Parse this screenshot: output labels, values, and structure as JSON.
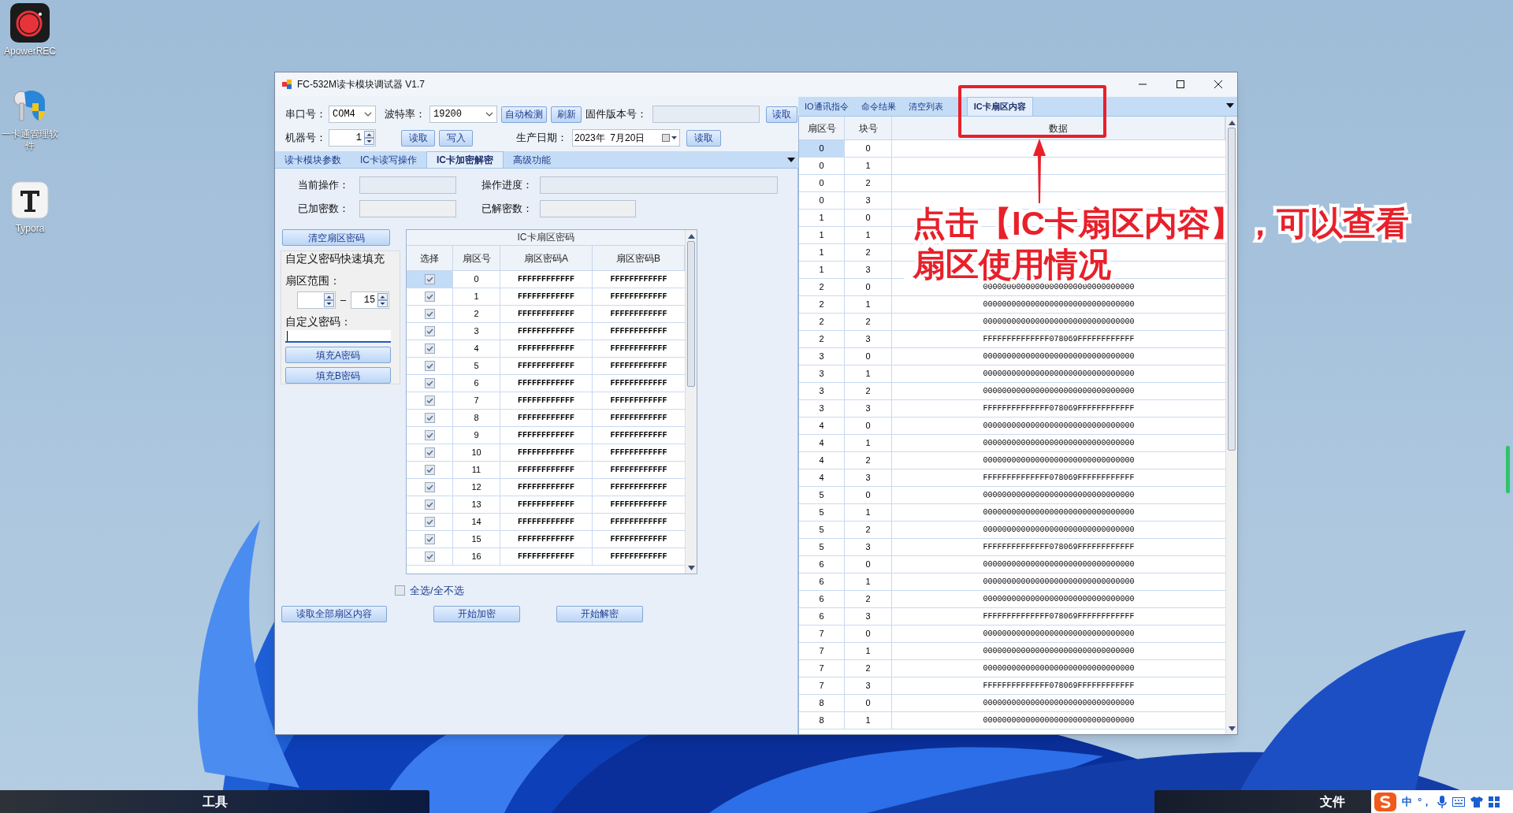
{
  "desktop": {
    "icons": [
      {
        "label": "ApowerREC",
        "kind": "recorder"
      },
      {
        "label": "一卡通管理软件",
        "kind": "keys"
      },
      {
        "label": "Typora",
        "kind": "typora"
      }
    ]
  },
  "window": {
    "title": "FC-532M读卡模块调试器 V1.7"
  },
  "toolbar": {
    "port_label": "串口号：",
    "port": "COM4",
    "baud_label": "波特率：",
    "baud": "19200",
    "auto_detect": "自动检测",
    "refresh": "刷新",
    "firmware_label": "固件版本号：",
    "firmware_read": "读取",
    "machine_label": "机器号：",
    "machine": "1",
    "machine_read": "读取",
    "machine_write": "写入",
    "date_label": "生产日期：",
    "date": "2023年  7月20日",
    "date_read": "读取"
  },
  "left_tabs": [
    {
      "label": "读卡模块参数",
      "selected": false
    },
    {
      "label": "IC卡读写操作",
      "selected": false
    },
    {
      "label": "IC卡加密解密",
      "selected": true
    },
    {
      "label": "高级功能",
      "selected": false
    }
  ],
  "crypto": {
    "current_op_label": "当前操作：",
    "progress_label": "操作进度：",
    "encrypted_label": "已加密数：",
    "decrypted_label": "已解密数：",
    "clear_button": "清空扇区密码",
    "quick_fill": {
      "title": "自定义密码快速填充",
      "range_label": "扇区范围：",
      "range_to": "15",
      "dash": "–",
      "password_label": "自定义密码：",
      "fill_a": "填充A密码",
      "fill_b": "填充B密码"
    },
    "table": {
      "title": "IC卡扇区密码",
      "columns": [
        "选择",
        "扇区号",
        "扇区密码A",
        "扇区密码B"
      ],
      "rows": [
        {
          "checked": true,
          "selected": true,
          "sector": "0",
          "key_a": "FFFFFFFFFFFF",
          "key_b": "FFFFFFFFFFFF"
        },
        {
          "checked": true,
          "selected": false,
          "sector": "1",
          "key_a": "FFFFFFFFFFFF",
          "key_b": "FFFFFFFFFFFF"
        },
        {
          "checked": true,
          "selected": false,
          "sector": "2",
          "key_a": "FFFFFFFFFFFF",
          "key_b": "FFFFFFFFFFFF"
        },
        {
          "checked": true,
          "selected": false,
          "sector": "3",
          "key_a": "FFFFFFFFFFFF",
          "key_b": "FFFFFFFFFFFF"
        },
        {
          "checked": true,
          "selected": false,
          "sector": "4",
          "key_a": "FFFFFFFFFFFF",
          "key_b": "FFFFFFFFFFFF"
        },
        {
          "checked": true,
          "selected": false,
          "sector": "5",
          "key_a": "FFFFFFFFFFFF",
          "key_b": "FFFFFFFFFFFF"
        },
        {
          "checked": true,
          "selected": false,
          "sector": "6",
          "key_a": "FFFFFFFFFFFF",
          "key_b": "FFFFFFFFFFFF"
        },
        {
          "checked": true,
          "selected": false,
          "sector": "7",
          "key_a": "FFFFFFFFFFFF",
          "key_b": "FFFFFFFFFFFF"
        },
        {
          "checked": true,
          "selected": false,
          "sector": "8",
          "key_a": "FFFFFFFFFFFF",
          "key_b": "FFFFFFFFFFFF"
        },
        {
          "checked": true,
          "selected": false,
          "sector": "9",
          "key_a": "FFFFFFFFFFFF",
          "key_b": "FFFFFFFFFFFF"
        },
        {
          "checked": true,
          "selected": false,
          "sector": "10",
          "key_a": "FFFFFFFFFFFF",
          "key_b": "FFFFFFFFFFFF"
        },
        {
          "checked": true,
          "selected": false,
          "sector": "11",
          "key_a": "FFFFFFFFFFFF",
          "key_b": "FFFFFFFFFFFF"
        },
        {
          "checked": true,
          "selected": false,
          "sector": "12",
          "key_a": "FFFFFFFFFFFF",
          "key_b": "FFFFFFFFFFFF"
        },
        {
          "checked": true,
          "selected": false,
          "sector": "13",
          "key_a": "FFFFFFFFFFFF",
          "key_b": "FFFFFFFFFFFF"
        },
        {
          "checked": true,
          "selected": false,
          "sector": "14",
          "key_a": "FFFFFFFFFFFF",
          "key_b": "FFFFFFFFFFFF"
        },
        {
          "checked": true,
          "selected": false,
          "sector": "15",
          "key_a": "FFFFFFFFFFFF",
          "key_b": "FFFFFFFFFFFF"
        },
        {
          "checked": true,
          "selected": false,
          "sector": "16",
          "key_a": "FFFFFFFFFFFF",
          "key_b": "FFFFFFFFFFFF"
        }
      ]
    },
    "select_all": {
      "label": "全选/全不选",
      "checked": false
    },
    "buttons": [
      "读取全部扇区内容",
      "开始加密",
      "开始解密"
    ]
  },
  "right_tabs": [
    {
      "label": "IO通讯指令",
      "selected": false
    },
    {
      "label": "命令结果",
      "selected": false
    },
    {
      "label": "清空列表",
      "selected": false
    },
    {
      "label": "IC卡扇区内容",
      "selected": true
    }
  ],
  "sector_table": {
    "columns": [
      "扇区号",
      "块号",
      "数据"
    ],
    "rows": [
      {
        "sector": "0",
        "block": "0",
        "selected": true
      },
      {
        "sector": "0",
        "block": "1",
        "selected": false
      },
      {
        "sector": "0",
        "block": "2",
        "selected": false
      },
      {
        "sector": "0",
        "block": "3",
        "selected": false
      },
      {
        "sector": "1",
        "block": "0",
        "selected": false
      },
      {
        "sector": "1",
        "block": "1",
        "selected": false
      },
      {
        "sector": "1",
        "block": "2",
        "selected": false
      },
      {
        "sector": "1",
        "block": "3",
        "selected": false
      },
      {
        "sector": "2",
        "block": "0",
        "selected": false,
        "data": "00000000000000000000000000000000"
      },
      {
        "sector": "2",
        "block": "1",
        "selected": false,
        "data": "00000000000000000000000000000000"
      },
      {
        "sector": "2",
        "block": "2",
        "selected": false,
        "data": "00000000000000000000000000000000"
      },
      {
        "sector": "2",
        "block": "3",
        "selected": false,
        "data": "FFFFFFFFFFFFFF078069FFFFFFFFFFFF"
      },
      {
        "sector": "3",
        "block": "0",
        "selected": false,
        "data": "00000000000000000000000000000000"
      },
      {
        "sector": "3",
        "block": "1",
        "selected": false,
        "data": "00000000000000000000000000000000"
      },
      {
        "sector": "3",
        "block": "2",
        "selected": false,
        "data": "00000000000000000000000000000000"
      },
      {
        "sector": "3",
        "block": "3",
        "selected": false,
        "data": "FFFFFFFFFFFFFF078069FFFFFFFFFFFF"
      },
      {
        "sector": "4",
        "block": "0",
        "selected": false,
        "data": "00000000000000000000000000000000"
      },
      {
        "sector": "4",
        "block": "1",
        "selected": false,
        "data": "00000000000000000000000000000000"
      },
      {
        "sector": "4",
        "block": "2",
        "selected": false,
        "data": "00000000000000000000000000000000"
      },
      {
        "sector": "4",
        "block": "3",
        "selected": false,
        "data": "FFFFFFFFFFFFFF078069FFFFFFFFFFFF"
      },
      {
        "sector": "5",
        "block": "0",
        "selected": false,
        "data": "00000000000000000000000000000000"
      },
      {
        "sector": "5",
        "block": "1",
        "selected": false,
        "data": "00000000000000000000000000000000"
      },
      {
        "sector": "5",
        "block": "2",
        "selected": false,
        "data": "00000000000000000000000000000000"
      },
      {
        "sector": "5",
        "block": "3",
        "selected": false,
        "data": "FFFFFFFFFFFFFF078069FFFFFFFFFFFF"
      },
      {
        "sector": "6",
        "block": "0",
        "selected": false,
        "data": "00000000000000000000000000000000"
      },
      {
        "sector": "6",
        "block": "1",
        "selected": false,
        "data": "00000000000000000000000000000000"
      },
      {
        "sector": "6",
        "block": "2",
        "selected": false,
        "data": "00000000000000000000000000000000"
      },
      {
        "sector": "6",
        "block": "3",
        "selected": false,
        "data": "FFFFFFFFFFFFFF078069FFFFFFFFFFFF"
      },
      {
        "sector": "7",
        "block": "0",
        "selected": false,
        "data": "00000000000000000000000000000000"
      },
      {
        "sector": "7",
        "block": "1",
        "selected": false,
        "data": "00000000000000000000000000000000"
      },
      {
        "sector": "7",
        "block": "2",
        "selected": false,
        "data": "00000000000000000000000000000000"
      },
      {
        "sector": "7",
        "block": "3",
        "selected": false,
        "data": "FFFFFFFFFFFFFF078069FFFFFFFFFFFF"
      },
      {
        "sector": "8",
        "block": "0",
        "selected": false,
        "data": "00000000000000000000000000000000"
      },
      {
        "sector": "8",
        "block": "1",
        "selected": false,
        "data": "00000000000000000000000000000000"
      }
    ]
  },
  "annotation": {
    "lines": [
      "点击【IC卡扇区内容】，可以查看",
      "扇区使用情况"
    ]
  },
  "taskbar": {
    "left_label": "工具",
    "right_label": "文件",
    "ime": [
      "中",
      "°，"
    ]
  }
}
